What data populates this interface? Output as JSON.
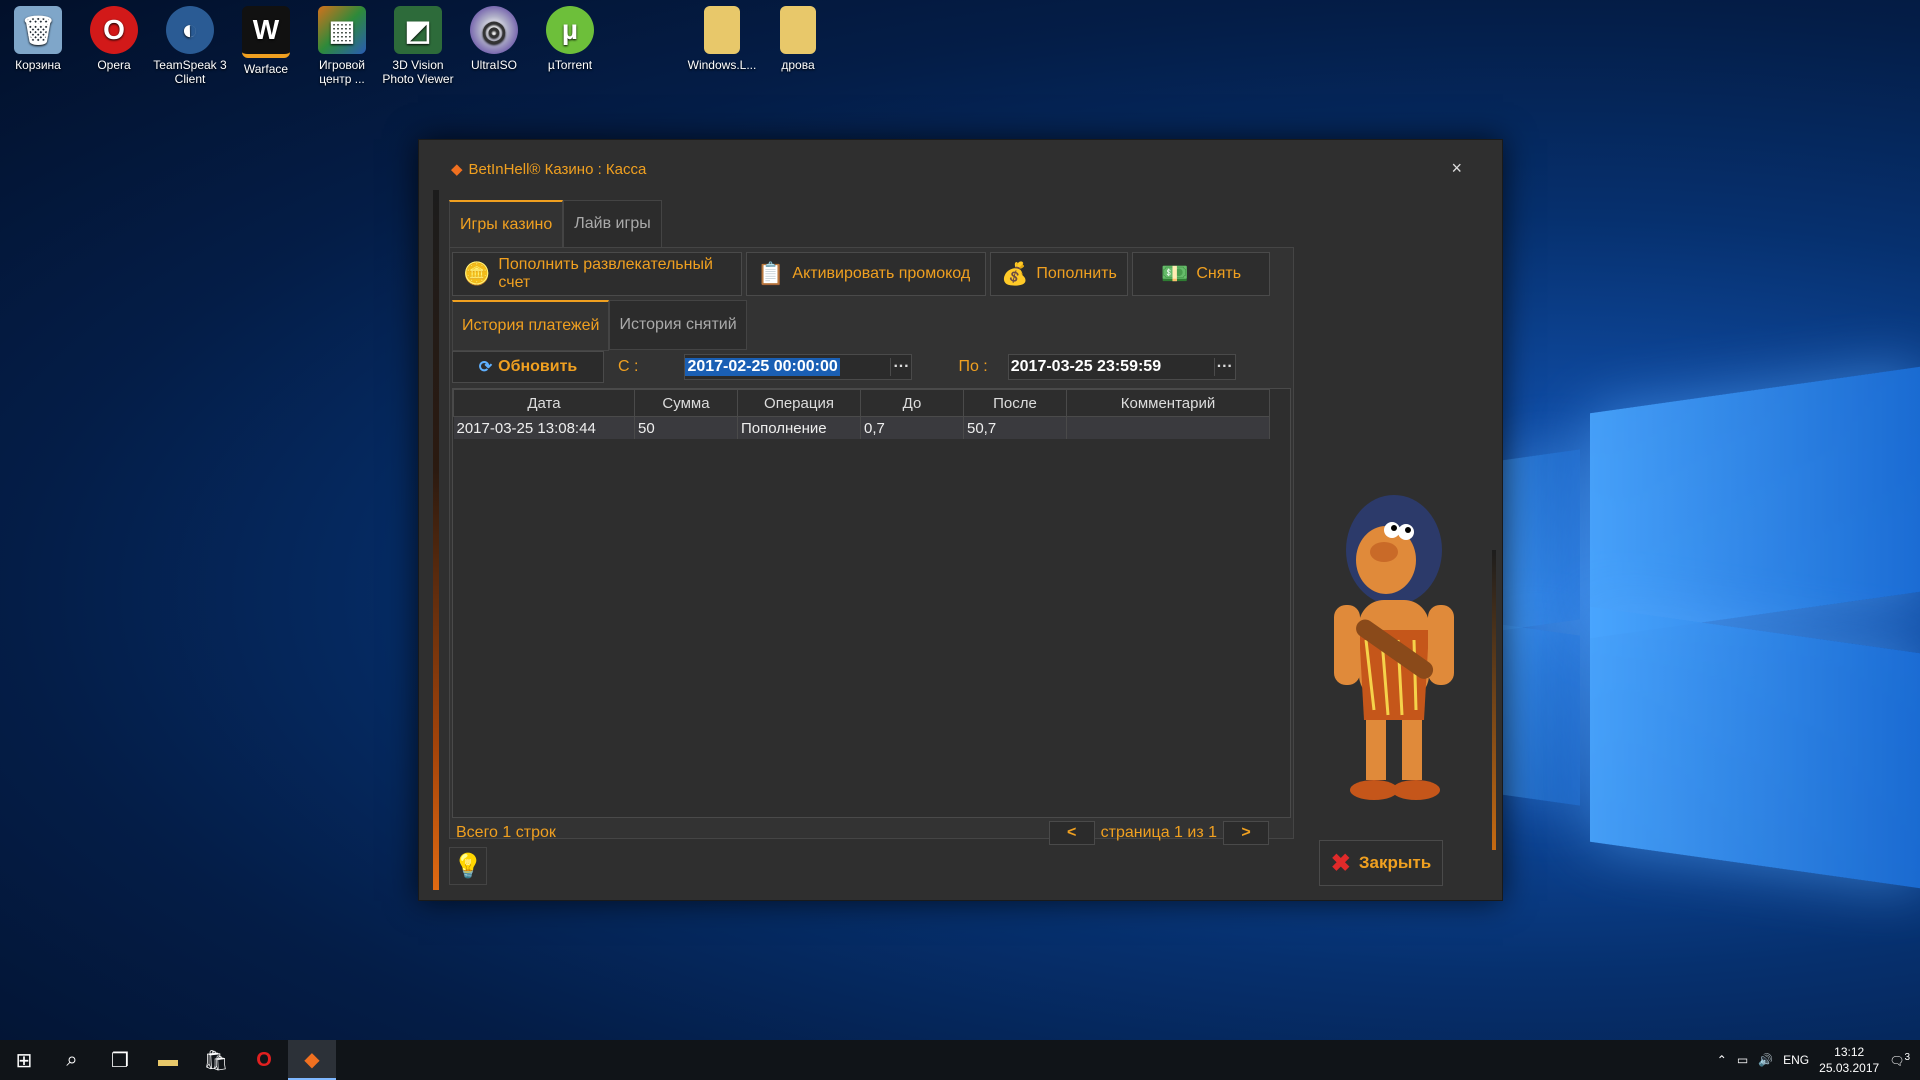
{
  "desktop": {
    "icons": [
      {
        "label": "Корзина",
        "glyph": "🗑",
        "color": "#7fa6c9"
      },
      {
        "label": "Opera",
        "glyph": "O",
        "color": "#d21919"
      },
      {
        "label": "TeamSpeak 3 Client",
        "glyph": "◐",
        "color": "#2a5b94"
      },
      {
        "label": "Warface",
        "glyph": "W",
        "color": "#111"
      },
      {
        "label": "Игровой центр ...",
        "glyph": "▦",
        "color": "#d3711c"
      },
      {
        "label": "3D Vision Photo Viewer",
        "glyph": "◩",
        "color": "#2d6b3a"
      },
      {
        "label": "UltraISO",
        "glyph": "◎",
        "color": "#b0b0c8"
      },
      {
        "label": "µTorrent",
        "glyph": "µ",
        "color": "#6dbf3a"
      },
      {
        "label": "Windows.L...",
        "glyph": "▯",
        "color": "#e8c86a"
      },
      {
        "label": "дрова",
        "glyph": "▯",
        "color": "#e8c86a"
      }
    ]
  },
  "window": {
    "title": "BetInHell® Казино : Касса",
    "close_glyph": "×",
    "tabs": [
      "Игры казино",
      "Лайв игры"
    ],
    "toolbar": {
      "deposit_fun": "Пополнить развлекательный счет",
      "promo": "Активировать промокод",
      "deposit": "Пополнить",
      "withdraw": "Снять"
    },
    "subtabs": [
      "История платежей",
      "История снятий"
    ],
    "filter": {
      "refresh": "Обновить",
      "from_label": "С :",
      "from_value": "2017-02-25 00:00:00",
      "to_label": "По :",
      "to_value": "2017-03-25 23:59:59",
      "dots": "···"
    },
    "table": {
      "headers": [
        "Дата",
        "Сумма",
        "Операция",
        "До",
        "После",
        "Комментарий"
      ],
      "rows": [
        [
          "2017-03-25 13:08:44",
          "50",
          "Пополнение",
          "0,7",
          "50,7",
          ""
        ]
      ]
    },
    "status": {
      "total": "Всего 1 строк",
      "prev": "<",
      "page": "страница 1 из 1",
      "next": ">"
    },
    "close_button": "Закрыть"
  },
  "taskbar": {
    "lang": "ENG",
    "time": "13:12",
    "date": "25.03.2017",
    "notifications": "3"
  }
}
